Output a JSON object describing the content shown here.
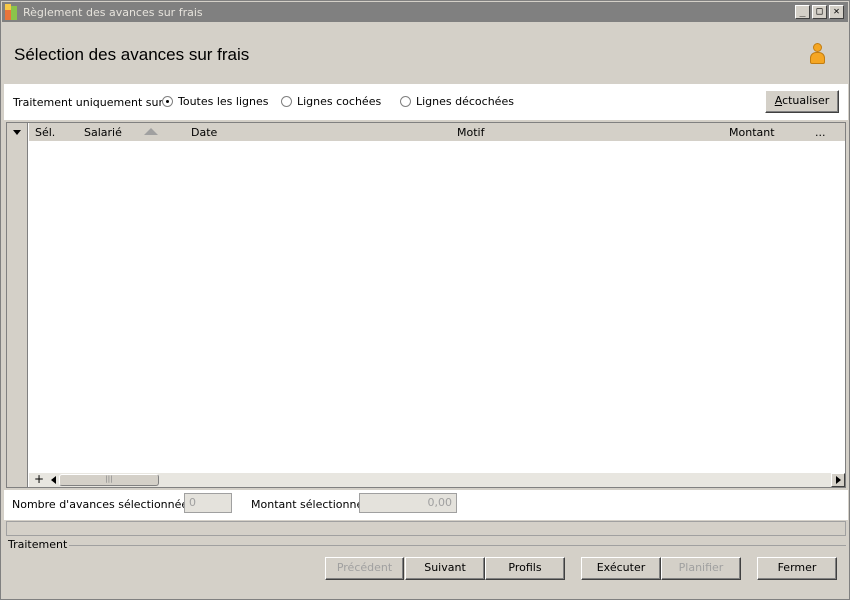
{
  "window": {
    "title": "Règlement des avances sur frais",
    "controls": {
      "minimize": "_",
      "maximize": "□",
      "close": "✕"
    }
  },
  "header": {
    "title": "Sélection des avances sur frais",
    "icon": "user-icon"
  },
  "filter": {
    "label": "Traitement uniquement sur :",
    "options": [
      {
        "label": "Toutes les lignes",
        "checked": true
      },
      {
        "label": "Lignes cochées",
        "checked": false
      },
      {
        "label": "Lignes décochées",
        "checked": false
      }
    ],
    "refresh_button": {
      "accel": "A",
      "rest": "ctualiser"
    }
  },
  "grid": {
    "columns": [
      "Sél.",
      "Salarié",
      "Date",
      "Motif",
      "Montant",
      "..."
    ],
    "rows": [],
    "scroll_plus": "+",
    "thumb_grip": "|||"
  },
  "summary": {
    "count_label": "Nombre d'avances sélectionnées :",
    "count_value": "0",
    "amount_label": "Montant sélectionné :",
    "amount_value": "0,00"
  },
  "processing": {
    "label": "Traitement"
  },
  "footer_buttons": [
    {
      "label": "Précédent",
      "enabled": false
    },
    {
      "label": "Suivant",
      "enabled": true
    },
    {
      "label": "Profils",
      "enabled": true
    },
    {
      "label": "Exécuter",
      "enabled": true
    },
    {
      "label": "Planifier",
      "enabled": false
    },
    {
      "label": "Fermer",
      "enabled": true
    }
  ]
}
